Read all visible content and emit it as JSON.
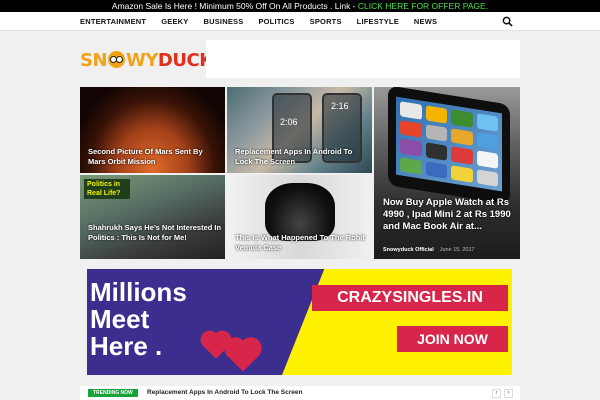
{
  "promo": {
    "text": "Amazon Sale Is Here ! Minimum 50% Off On All Products . Link - ",
    "link_label": "CLICK HERE FOR OFFER PAGE."
  },
  "nav": {
    "items": [
      "ENTERTAINMENT",
      "GEEKY",
      "BUSINESS",
      "POLITICS",
      "SPORTS",
      "LIFESTYLE",
      "NEWS"
    ]
  },
  "logo": {
    "part1": "SN",
    "part2": "WY",
    "part3": "DUCK"
  },
  "tiles": {
    "mars": "Second Picture Of Mars Sent By Mars Orbit Mission",
    "android": "Replacement Apps In Android To Lock The Screen",
    "android_clock_a": "2:06",
    "android_clock_b": "2:16",
    "shahrukh_tag": "Politics in Real Life?",
    "shahrukh": "Shahrukh Says He’s Not Interested In Politics : This Is Not for Me!",
    "rohit": "This Is What Happened To The Rohit Vemula Case",
    "apple": "Now Buy Apple Watch at Rs 4990 , Ipad Mini 2 at Rs 1990 and Mac Book Air at...",
    "apple_author": "Snowyduck Official",
    "apple_date": "June 15, 2017"
  },
  "banner": {
    "headline_1": "Millions",
    "headline_2": "Meet",
    "headline_3": "Here .",
    "brand": "CRAZYSINGLES.IN",
    "cta": "JOIN NOW"
  },
  "trending": {
    "badge": "TRENDING NOW",
    "text": "Replacement Apps In Android To Lock The Screen",
    "prev": "‹",
    "next": "›"
  }
}
